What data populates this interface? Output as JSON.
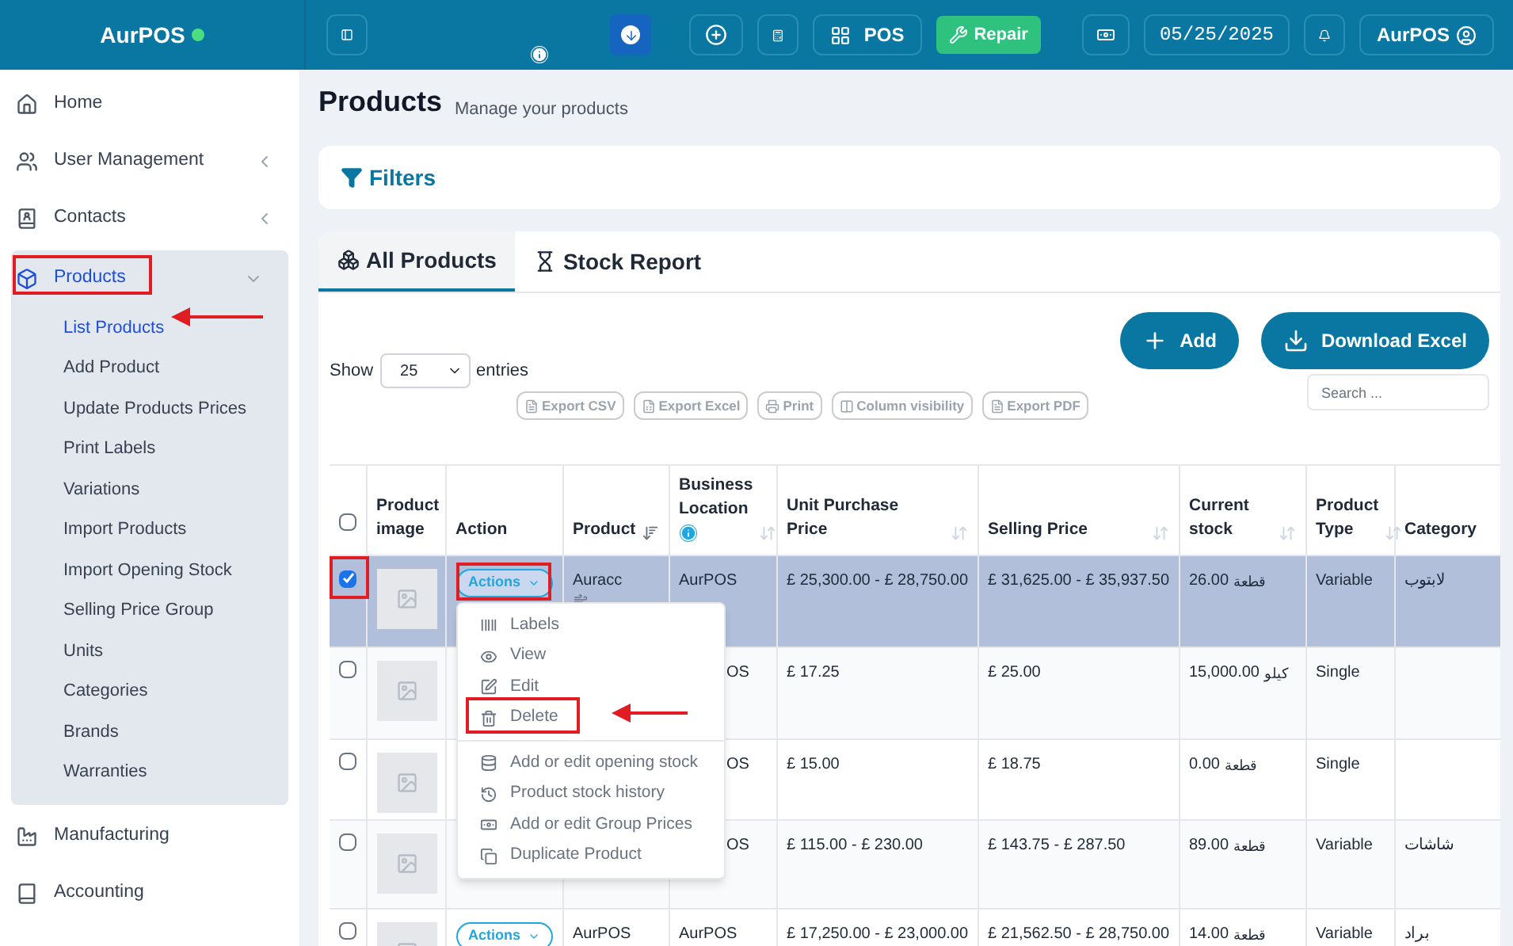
{
  "brand": {
    "name": "AurPOS",
    "online": true
  },
  "topbar": {
    "pos_label": "POS",
    "repair_label": "Repair",
    "date": "05/25/2025",
    "user": "AurPOS"
  },
  "sidebar": {
    "items": [
      {
        "label": "Home",
        "selected": false
      },
      {
        "label": "User Management",
        "selected": false,
        "expanded": false
      },
      {
        "label": "Contacts",
        "selected": false,
        "expanded": false
      },
      {
        "label": "Products",
        "selected": true,
        "expanded": true,
        "children": [
          {
            "label": "List Products",
            "selected": true
          },
          {
            "label": "Add Product",
            "selected": false
          },
          {
            "label": "Update Products Prices",
            "selected": false
          },
          {
            "label": "Print Labels",
            "selected": false
          },
          {
            "label": "Variations",
            "selected": false
          },
          {
            "label": "Import Products",
            "selected": false
          },
          {
            "label": "Import Opening Stock",
            "selected": false
          },
          {
            "label": "Selling Price Group",
            "selected": false
          },
          {
            "label": "Units",
            "selected": false
          },
          {
            "label": "Categories",
            "selected": false
          },
          {
            "label": "Brands",
            "selected": false
          },
          {
            "label": "Warranties",
            "selected": false
          }
        ]
      },
      {
        "label": "Manufacturing",
        "selected": false
      },
      {
        "label": "Accounting",
        "selected": false
      }
    ]
  },
  "page": {
    "title": "Products",
    "subtitle": "Manage your products"
  },
  "filters": {
    "label": "Filters"
  },
  "tabs": [
    {
      "label": "All Products",
      "selected": true
    },
    {
      "label": "Stock Report",
      "selected": false
    }
  ],
  "toolbar": {
    "add_label": "Add",
    "download_label": "Download Excel",
    "show_label": "Show",
    "page_size": "25",
    "entries_label": "entries",
    "search_placeholder": "Search ...",
    "exports": [
      "Export CSV",
      "Export Excel",
      "Print",
      "Column visibility",
      "Export PDF"
    ]
  },
  "table": {
    "select_all_checked": false,
    "columns": [
      "Product image",
      "Action",
      "Product",
      "Business Location",
      "Unit Purchase Price",
      "Selling Price",
      "Current stock",
      "Product Type",
      "Category"
    ],
    "rows": [
      {
        "selected": true,
        "actions": "Actions",
        "product": "Auracc",
        "location": "AurPOS",
        "unit_price": "£ 25,300.00 - £ 28,750.00",
        "selling_price": "£ 31,625.00 - £ 35,937.50",
        "stock": "26.00",
        "unit": "قطعة",
        "type": "Variable",
        "category": "لابتوب"
      },
      {
        "selected": false,
        "location": "OS",
        "unit_price": "£ 17.25",
        "selling_price": "£ 25.00",
        "stock": "15,000.00",
        "unit": "كيلو",
        "type": "Single"
      },
      {
        "selected": false,
        "location": "OS",
        "unit_price": "£ 15.00",
        "selling_price": "£ 18.75",
        "stock": "0.00",
        "unit": "قطعة",
        "type": "Single"
      },
      {
        "selected": false,
        "location": "OS",
        "unit_price": "£ 115.00 - £ 230.00",
        "selling_price": "£ 143.75 - £ 287.50",
        "stock": "89.00",
        "unit": "قطعة",
        "type": "Variable",
        "category": "شاشات"
      },
      {
        "selected": false,
        "actions": "Actions",
        "product": "AurPOS",
        "location": "AurPOS",
        "unit_price": "£ 17,250.00 - £ 23,000.00",
        "selling_price": "£ 21,562.50 - £ 28,750.00",
        "stock": "14.00",
        "unit": "قطعة",
        "type": "Variable",
        "category": "براد"
      }
    ]
  },
  "action_menu": [
    {
      "kind": "item",
      "label": "Labels"
    },
    {
      "kind": "item",
      "label": "View"
    },
    {
      "kind": "item",
      "label": "Edit"
    },
    {
      "kind": "item",
      "label": "Delete"
    },
    {
      "kind": "divider"
    },
    {
      "kind": "item",
      "label": "Add or edit opening stock"
    },
    {
      "kind": "item",
      "label": "Product stock history"
    },
    {
      "kind": "item",
      "label": "Add or edit Group Prices"
    },
    {
      "kind": "item",
      "label": "Duplicate Product"
    }
  ]
}
